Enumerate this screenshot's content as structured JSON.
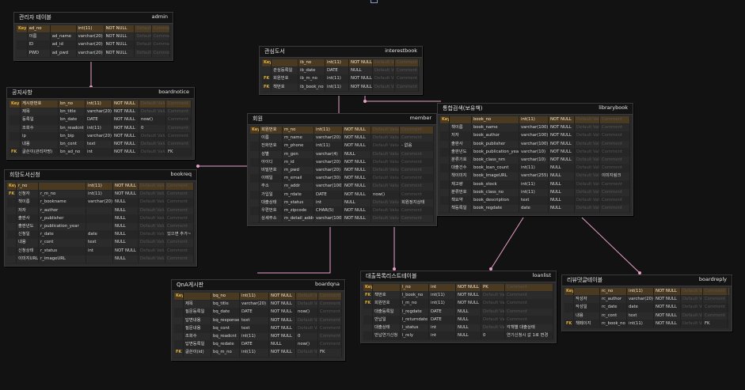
{
  "defaults": {
    "default_label": "Default Value",
    "comment_label": "Comment"
  },
  "tables": [
    {
      "id": "admin",
      "title": "관리자 테이블",
      "name": "admin",
      "rows": [
        {
          "key": "Key",
          "logical": "ad_no",
          "physical": "",
          "type": "int(11)",
          "null": "NOT NULL",
          "default": "",
          "comment": "",
          "head": true
        },
        {
          "key": "",
          "logical": "이름",
          "physical": "ad_name",
          "type": "varchar(20)",
          "null": "NOT NULL",
          "default": "",
          "comment": ""
        },
        {
          "key": "",
          "logical": "ID",
          "physical": "ad_id",
          "type": "varchar(20)",
          "null": "NOT NULL",
          "default": "",
          "comment": ""
        },
        {
          "key": "",
          "logical": "PWD",
          "physical": "ad_pwd",
          "type": "varchar(20)",
          "null": "NOT NULL",
          "default": "",
          "comment": ""
        }
      ]
    },
    {
      "id": "interestbook",
      "title": "관심도서",
      "name": "interestbook",
      "rows": [
        {
          "key": "Key",
          "logical": "",
          "physical": "ib_no",
          "type": "int(11)",
          "null": "NOT NULL",
          "default": "",
          "comment": "",
          "head": true
        },
        {
          "key": "",
          "logical": "관심등록일",
          "physical": "ib_date",
          "type": "DATE",
          "null": "NULL",
          "default": "",
          "comment": ""
        },
        {
          "key": "FK",
          "logical": "회원번호",
          "physical": "ib_m_no",
          "type": "int(11)",
          "null": "NOT NULL",
          "default": "",
          "comment": ""
        },
        {
          "key": "FK",
          "logical": "책번호",
          "physical": "ib_book_no",
          "type": "int(11)",
          "null": "NOT NULL",
          "default": "",
          "comment": ""
        }
      ]
    },
    {
      "id": "boardnotice",
      "title": "공지사항",
      "name": "boardnotice",
      "rows": [
        {
          "key": "Key",
          "logical": "게시판번호",
          "physical": "bn_no",
          "type": "int(11)",
          "null": "NOT NULL",
          "default": "",
          "comment": "",
          "head": true
        },
        {
          "key": "",
          "logical": "제목",
          "physical": "bn_title",
          "type": "varchar(20)",
          "null": "NOT NULL",
          "default": "",
          "comment": ""
        },
        {
          "key": "",
          "logical": "등록일",
          "physical": "bn_date",
          "type": "DATE",
          "null": "NOT NULL",
          "default": "now()",
          "comment": ""
        },
        {
          "key": "",
          "logical": "조회수",
          "physical": "bn_readcnt",
          "type": "int(11)",
          "null": "NOT NULL",
          "default": "0",
          "comment": ""
        },
        {
          "key": "",
          "logical": "ip",
          "physical": "bn_bip",
          "type": "varchar(20)",
          "null": "NOT NULL",
          "default": "",
          "comment": ""
        },
        {
          "key": "",
          "logical": "내용",
          "physical": "bn_cont",
          "type": "text",
          "null": "NOT NULL",
          "default": "",
          "comment": ""
        },
        {
          "key": "FK",
          "logical": "글쓴이(관리자명)",
          "physical": "bn_ad_no",
          "type": "int",
          "null": "NOT NULL",
          "default": "",
          "comment": "FK"
        }
      ]
    },
    {
      "id": "member",
      "title": "회원",
      "name": "member",
      "rows": [
        {
          "key": "Key",
          "logical": "회원번호",
          "physical": "m_no",
          "type": "int(11)",
          "null": "NOT NULL",
          "default": "",
          "comment": "",
          "head": true
        },
        {
          "key": "",
          "logical": "이름",
          "physical": "m_name",
          "type": "varchar(20)",
          "null": "NOT NULL",
          "default": "",
          "comment": ""
        },
        {
          "key": "",
          "logical": "전화번호",
          "physical": "m_phone",
          "type": "int(11)",
          "null": "NOT NULL",
          "default": "",
          "comment": "- 없음"
        },
        {
          "key": "",
          "logical": "성별",
          "physical": "m_gen",
          "type": "varchar(4)",
          "null": "NULL",
          "default": "",
          "comment": ""
        },
        {
          "key": "",
          "logical": "아이디",
          "physical": "m_id",
          "type": "varchar(20)",
          "null": "NOT NULL",
          "default": "",
          "comment": ""
        },
        {
          "key": "",
          "logical": "비밀번호",
          "physical": "m_pwd",
          "type": "varchar(20)",
          "null": "NOT NULL",
          "default": "",
          "comment": ""
        },
        {
          "key": "",
          "logical": "이메일",
          "physical": "m_email",
          "type": "varchar(30)",
          "null": "NOT NULL",
          "default": "",
          "comment": ""
        },
        {
          "key": "",
          "logical": "주소",
          "physical": "m_addr",
          "type": "varchar(100)",
          "null": "NOT NULL",
          "default": "",
          "comment": ""
        },
        {
          "key": "",
          "logical": "가입일",
          "physical": "m_rdate",
          "type": "DATE",
          "null": "NOT NULL",
          "default": "now()",
          "comment": ""
        },
        {
          "key": "",
          "logical": "대출상태",
          "physical": "m_status",
          "type": "int",
          "null": "NULL",
          "default": "",
          "comment": "회원정지상태"
        },
        {
          "key": "",
          "logical": "우편번호",
          "physical": "m_zipcode",
          "type": "CHAR(5)",
          "null": "NOT NULL",
          "default": "",
          "comment": ""
        },
        {
          "key": "",
          "logical": "상세주소",
          "physical": "m_detail_addr",
          "type": "varchar(100)",
          "null": "NOT NULL",
          "default": "",
          "comment": ""
        }
      ]
    },
    {
      "id": "librarybook",
      "title": "통합검색(보유책)",
      "name": "librarybook",
      "rows": [
        {
          "key": "Key",
          "logical": "",
          "physical": "book_no",
          "type": "int(11)",
          "null": "NOT NULL",
          "default": "",
          "comment": "",
          "head": true
        },
        {
          "key": "",
          "logical": "책이름",
          "physical": "book_name",
          "type": "varchar(100)",
          "null": "NOT NULL",
          "default": "",
          "comment": ""
        },
        {
          "key": "",
          "logical": "저자",
          "physical": "book_author",
          "type": "varchar(100)",
          "null": "NOT NULL",
          "default": "",
          "comment": ""
        },
        {
          "key": "",
          "logical": "출판사",
          "physical": "book_publisher",
          "type": "varchar(100)",
          "null": "NOT NULL",
          "default": "",
          "comment": ""
        },
        {
          "key": "",
          "logical": "출판년도",
          "physical": "book_publication_year",
          "type": "varchar(10)",
          "null": "NOT NULL",
          "default": "",
          "comment": ""
        },
        {
          "key": "",
          "logical": "분류기호",
          "physical": "book_class_nm",
          "type": "varchar(10)",
          "null": "NOT NULL",
          "default": "",
          "comment": ""
        },
        {
          "key": "",
          "logical": "대출건수",
          "physical": "book_loan_count",
          "type": "int(11)",
          "null": "NULL",
          "default": "",
          "comment": ""
        },
        {
          "key": "",
          "logical": "책이미지",
          "physical": "book_ImageURL",
          "type": "varchar(255)",
          "null": "NULL",
          "default": "",
          "comment": "이미지링크"
        },
        {
          "key": "",
          "logical": "재고량",
          "physical": "book_stock",
          "type": "int(11)",
          "null": "NULL",
          "default": "",
          "comment": ""
        },
        {
          "key": "",
          "logical": "분류번호",
          "physical": "book_class_no",
          "type": "int(11)",
          "null": "NULL",
          "default": "",
          "comment": ""
        },
        {
          "key": "",
          "logical": "책요약",
          "physical": "book_description",
          "type": "text",
          "null": "NULL",
          "default": "",
          "comment": ""
        },
        {
          "key": "",
          "logical": "책등록일",
          "physical": "book_regdate",
          "type": "date",
          "null": "NULL",
          "default": "",
          "comment": ""
        }
      ]
    },
    {
      "id": "bookreq",
      "title": "희망도서신청",
      "name": "bookreq",
      "rows": [
        {
          "key": "Key",
          "logical": "r_no",
          "physical": "",
          "type": "int(11)",
          "null": "NOT NULL",
          "default": "",
          "comment": "",
          "head": true
        },
        {
          "key": "FK",
          "logical": "신청자",
          "physical": "r_m_no",
          "type": "int(11)",
          "null": "NOT NULL",
          "default": "",
          "comment": ""
        },
        {
          "key": "",
          "logical": "책이름",
          "physical": "r_bookname",
          "type": "varchar(20)",
          "null": "NULL",
          "default": "",
          "comment": ""
        },
        {
          "key": "",
          "logical": "저자",
          "physical": "r_author",
          "type": "",
          "null": "NULL",
          "default": "",
          "comment": ""
        },
        {
          "key": "",
          "logical": "출판사",
          "physical": "r_publisher",
          "type": "",
          "null": "NULL",
          "default": "",
          "comment": ""
        },
        {
          "key": "",
          "logical": "출판년도",
          "physical": "r_publication_year",
          "type": "",
          "null": "NULL",
          "default": "",
          "comment": ""
        },
        {
          "key": "",
          "logical": "신청일",
          "physical": "r_date",
          "type": "date",
          "null": "NULL",
          "default": "",
          "comment": "있으면 추가~"
        },
        {
          "key": "",
          "logical": "내용",
          "physical": "r_cont",
          "type": "text",
          "null": "NULL",
          "default": "",
          "comment": ""
        },
        {
          "key": "",
          "logical": "신청상태",
          "physical": "r_status",
          "type": "int",
          "null": "NOT NULL",
          "default": "",
          "comment": ""
        },
        {
          "key": "",
          "logical": "이미지URL",
          "physical": "r_imageURL",
          "type": "",
          "null": "NULL",
          "default": "",
          "comment": ""
        }
      ]
    },
    {
      "id": "boardqna",
      "title": "QnA게시판",
      "name": "boardqna",
      "rows": [
        {
          "key": "Key",
          "logical": "",
          "physical": "bq_no",
          "type": "int(11)",
          "null": "NOT NULL",
          "default": "",
          "comment": "",
          "head": true
        },
        {
          "key": "",
          "logical": "제목",
          "physical": "bq_title",
          "type": "varchar(20)",
          "null": "NOT NULL",
          "default": "",
          "comment": ""
        },
        {
          "key": "",
          "logical": "질문등록일",
          "physical": "bq_date",
          "type": "DATE",
          "null": "NOT NULL",
          "default": "now()",
          "comment": ""
        },
        {
          "key": "",
          "logical": "답변내용",
          "physical": "bq_response",
          "type": "text",
          "null": "NOT NULL",
          "default": "",
          "comment": ""
        },
        {
          "key": "",
          "logical": "질문내용",
          "physical": "bq_cont",
          "type": "text",
          "null": "NOT NULL",
          "default": "",
          "comment": ""
        },
        {
          "key": "",
          "logical": "조회수",
          "physical": "bq_readcnt",
          "type": "int(11)",
          "null": "NOT NULL",
          "default": "0",
          "comment": ""
        },
        {
          "key": "",
          "logical": "답변등록일",
          "physical": "bq_redate",
          "type": "DATE",
          "null": "NULL",
          "default": "now()",
          "comment": ""
        },
        {
          "key": "FK",
          "logical": "글쓴이(id)",
          "physical": "bq_m_no",
          "type": "int(11)",
          "null": "NOT NULL",
          "default": "",
          "comment": "FK"
        }
      ]
    },
    {
      "id": "loanlist",
      "title": "대출목록리스트테이블",
      "name": "loanlist",
      "rows": [
        {
          "key": "Key",
          "logical": "",
          "physical": "l_no",
          "type": "int",
          "null": "NOT NULL",
          "default": "PK",
          "comment": "",
          "head": true
        },
        {
          "key": "FK",
          "logical": "책번호",
          "physical": "l_book_no",
          "type": "int(11)",
          "null": "NOT NULL",
          "default": "",
          "comment": ""
        },
        {
          "key": "FK",
          "logical": "회원번호",
          "physical": "l_m_no",
          "type": "int(11)",
          "null": "NOT NULL",
          "default": "",
          "comment": ""
        },
        {
          "key": "",
          "logical": "대출등록일",
          "physical": "l_regdate",
          "type": "DATE",
          "null": "NULL",
          "default": "",
          "comment": ""
        },
        {
          "key": "",
          "logical": "반납일",
          "physical": "l_returndate",
          "type": "DATE",
          "null": "NULL",
          "default": "",
          "comment": ""
        },
        {
          "key": "",
          "logical": "대출상태",
          "physical": "l_status",
          "type": "int",
          "null": "NULL",
          "default": "",
          "comment": "각책별 대출상태"
        },
        {
          "key": "",
          "logical": "반납연기신청",
          "physical": "l_rely",
          "type": "int",
          "null": "NULL",
          "default": "0",
          "comment": "연기신청시 값 1로 변경"
        }
      ]
    },
    {
      "id": "boardreply",
      "title": "리뷰댓글테이블",
      "name": "boardreply",
      "rows": [
        {
          "key": "Key",
          "logical": "",
          "physical": "rc_no",
          "type": "int(11)",
          "null": "NOT NULL",
          "default": "",
          "comment": "",
          "head": true
        },
        {
          "key": "",
          "logical": "작성자",
          "physical": "rc_author",
          "type": "varchar(20)",
          "null": "NOT NULL",
          "default": "",
          "comment": ""
        },
        {
          "key": "",
          "logical": "작성일",
          "physical": "rc_date",
          "type": "date",
          "null": "NOT NULL",
          "default": "",
          "comment": ""
        },
        {
          "key": "",
          "logical": "내용",
          "physical": "rc_cont",
          "type": "text",
          "null": "NOT NULL",
          "default": "",
          "comment": ""
        },
        {
          "key": "FK",
          "logical": "책페이지",
          "physical": "rc_book_no",
          "type": "int(11)",
          "null": "NOT NULL",
          "default": "",
          "comment": "FK"
        }
      ]
    }
  ],
  "colors": {
    "canvas": "#121212",
    "table_body": "#2b2b2b",
    "table_header": "#141414",
    "key_row": "#4b3a22",
    "relation_line": "#e8a0c8"
  }
}
